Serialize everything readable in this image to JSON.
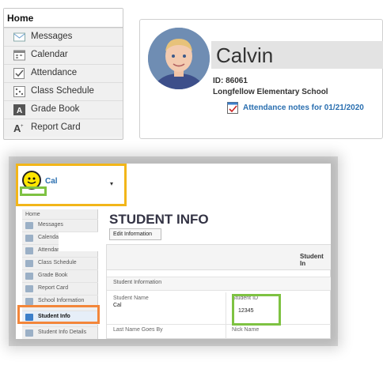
{
  "top": {
    "home_label": "Home",
    "nav_items": [
      {
        "label": "Messages",
        "icon": "messages-icon"
      },
      {
        "label": "Calendar",
        "icon": "calendar-icon"
      },
      {
        "label": "Attendance",
        "icon": "attendance-icon"
      },
      {
        "label": "Class Schedule",
        "icon": "schedule-icon"
      },
      {
        "label": "Grade Book",
        "icon": "gradebook-icon"
      },
      {
        "label": "Report Card",
        "icon": "report-card-icon"
      }
    ],
    "student_name": "Calvin",
    "student_id": "ID: 86061",
    "school": "Longfellow Elementary School",
    "attendance_link": "Attendance notes for 01/21/2020"
  },
  "bottom": {
    "user_name": "Cal",
    "left_nav": {
      "home": "Home",
      "items": [
        {
          "label": "Messages"
        },
        {
          "label": "Calendar"
        },
        {
          "label": "Attendance"
        },
        {
          "label": "Class Schedule"
        },
        {
          "label": "Grade Book"
        },
        {
          "label": "Report Card"
        },
        {
          "label": "School Information"
        },
        {
          "label": "Student Info"
        },
        {
          "label": "Student Info Details"
        }
      ]
    },
    "page_title": "STUDENT INFO",
    "edit_button": "Edit Information",
    "student_header": "Student In",
    "section_label": "Student Information",
    "fields": {
      "student_name_label": "Student Name",
      "student_name_value": "Cal",
      "student_id_label": "Student ID",
      "student_id_value": "12345",
      "last_name_label": "Last Name Goes By",
      "nick_name_label": "Nick Name"
    }
  },
  "colors": {
    "accent_blue": "#2a6fb0",
    "highlight_yellow": "#f2b619",
    "highlight_green": "#7ec242",
    "highlight_orange": "#f3863a"
  }
}
